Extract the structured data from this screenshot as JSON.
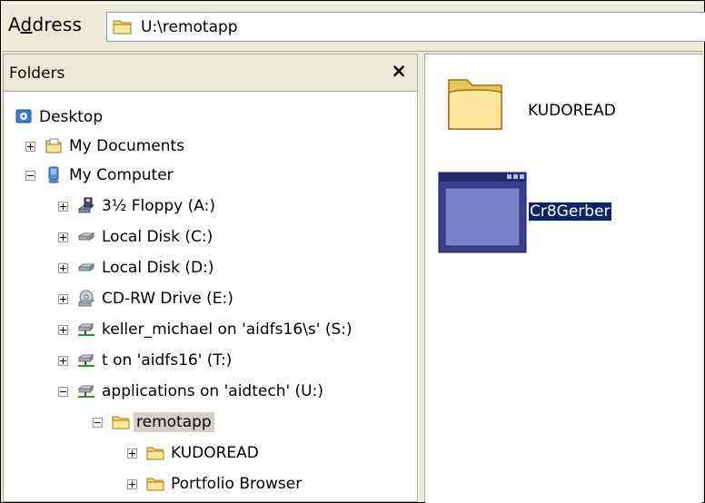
{
  "address_bar": {
    "label_prefix": "A",
    "label_access_key": "d",
    "label_suffix": "dress",
    "path": "U:\\remotapp",
    "icon": "folder-icon"
  },
  "folders_pane": {
    "title": "Folders",
    "close_glyph": "×",
    "tree": [
      {
        "label": "Desktop",
        "icon": "desktop-icon",
        "expander": "none",
        "selected": false
      },
      {
        "label": "My Documents",
        "icon": "my-documents-icon",
        "expander": "plus",
        "selected": false
      },
      {
        "label": "My Computer",
        "icon": "my-computer-icon",
        "expander": "minus",
        "selected": false
      },
      {
        "label": "3½ Floppy (A:)",
        "icon": "floppy-drive-icon",
        "expander": "plus",
        "selected": false
      },
      {
        "label": "Local Disk (C:)",
        "icon": "hard-disk-icon",
        "expander": "plus",
        "selected": false
      },
      {
        "label": "Local Disk (D:)",
        "icon": "hard-disk-icon",
        "expander": "plus",
        "selected": false
      },
      {
        "label": "CD-RW Drive (E:)",
        "icon": "cd-drive-icon",
        "expander": "plus",
        "selected": false
      },
      {
        "label": "keller_michael on 'aidfs16\\s' (S:)",
        "icon": "network-drive-icon",
        "expander": "plus",
        "selected": false
      },
      {
        "label": "t on 'aidfs16' (T:)",
        "icon": "network-drive-icon",
        "expander": "plus",
        "selected": false
      },
      {
        "label": "applications on 'aidtech' (U:)",
        "icon": "network-drive-icon",
        "expander": "minus",
        "selected": false
      },
      {
        "label": "remotapp",
        "icon": "open-folder-icon",
        "expander": "minus",
        "selected": true
      },
      {
        "label": "KUDOREAD",
        "icon": "folder-icon",
        "expander": "plus",
        "selected": false
      },
      {
        "label": "Portfolio Browser",
        "icon": "folder-icon",
        "expander": "plus",
        "selected": false
      }
    ]
  },
  "contents": {
    "items": [
      {
        "label": "KUDOREAD",
        "icon": "large-folder-icon",
        "selected": false
      },
      {
        "label": "Cr8Gerber",
        "icon": "application-icon",
        "selected": true
      }
    ]
  },
  "colors": {
    "chrome": "#ece9d8",
    "selection": "#0a246a",
    "folder_yellow": "#f5d774"
  }
}
